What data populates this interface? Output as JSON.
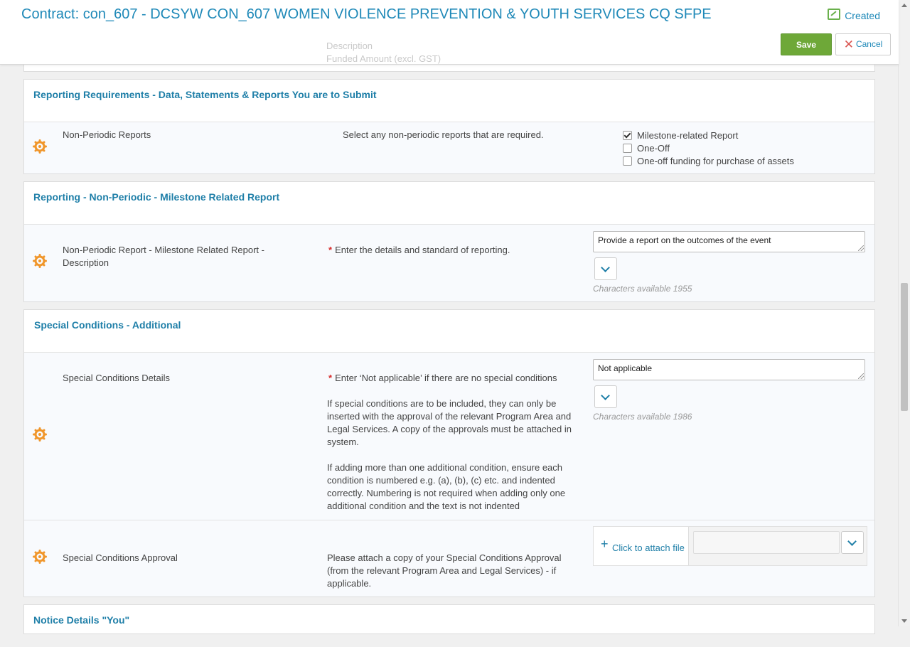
{
  "header": {
    "title": "Contract: con_607 - DCSYW CON_607 WOMEN VIOLENCE PREVENTION & YOUTH SERVICES CQ SFPE",
    "status": "Created",
    "save_label": "Save",
    "cancel_label": "Cancel",
    "ghost_line1": "Description",
    "ghost_line2": "Funded Amount (excl. GST)"
  },
  "sections": {
    "reporting": {
      "heading": "Reporting Requirements - Data, Statements & Reports You are to Submit",
      "label": "Non-Periodic Reports",
      "help": "Select any non-periodic reports that are required.",
      "options": [
        {
          "label": "Milestone-related Report",
          "checked": true
        },
        {
          "label": "One-Off",
          "checked": false
        },
        {
          "label": "One-off funding for purchase of assets",
          "checked": false
        }
      ]
    },
    "milestone": {
      "heading": "Reporting - Non-Periodic - Milestone Related Report",
      "label": "Non-Periodic Report - Milestone Related Report - Description",
      "help": "Enter the details and standard of reporting.",
      "value": "Provide a report on the outcomes of the event",
      "chars": "Characters available 1955"
    },
    "special": {
      "heading": "Special Conditions - Additional",
      "details_label": "Special Conditions Details",
      "details_help_1": "Enter ‘Not applicable’ if there are no special conditions",
      "details_help_2": "If special conditions are to be included, they can only be inserted with the approval of the relevant Program Area and Legal Services. A copy of the approvals must be attached in system.",
      "details_help_3": "If adding more than one additional condition, ensure each condition is numbered e.g. (a), (b), (c) etc. and indented correctly. Numbering is not required when adding only one additional condition and the text is not indented",
      "details_value": "Not applicable",
      "details_chars": "Characters available 1986",
      "approval_label": "Special Conditions Approval",
      "approval_help": "Please attach a copy of your Special Conditions Approval (from the relevant Program Area and Legal Services) - if applicable.",
      "attach_label": "Click to attach file"
    },
    "notice": {
      "heading": "Notice Details \"You\""
    }
  },
  "colors": {
    "accent": "#1f7fa8",
    "save": "#6ea838",
    "gear": "#f0962b",
    "required": "#d62b2b"
  },
  "icons": [
    "created-status-icon",
    "cancel-x-icon",
    "gear-icon",
    "chevron-down-icon",
    "plus-icon"
  ]
}
